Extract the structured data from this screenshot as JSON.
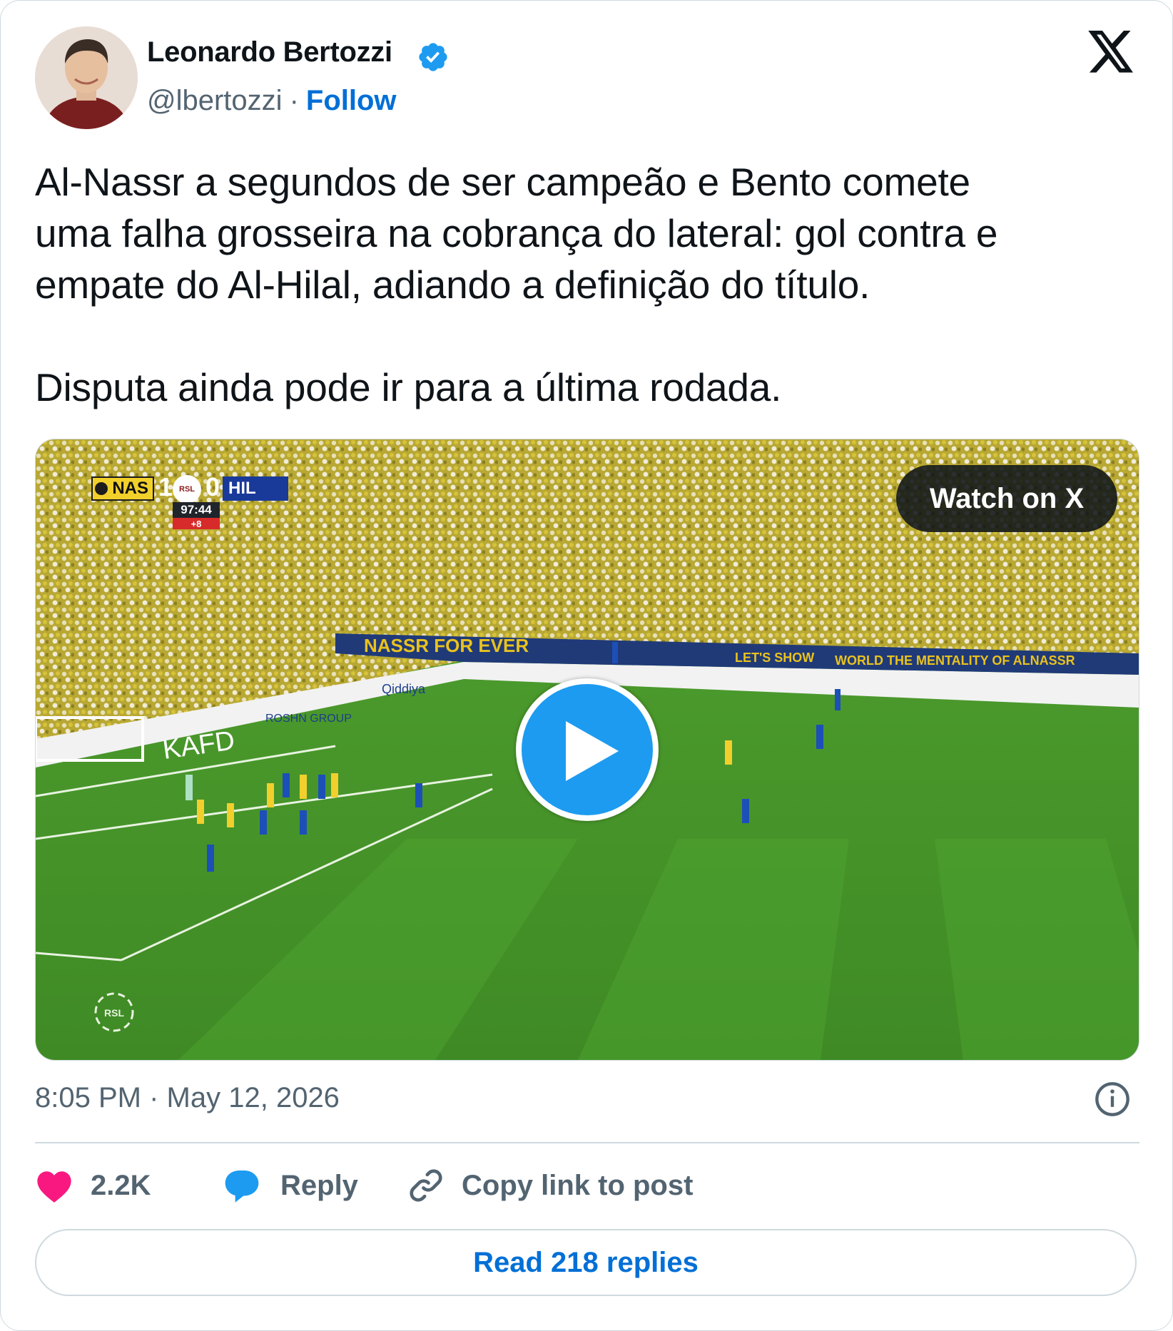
{
  "author": {
    "name": "Leonardo Bertozzi",
    "handle": "@lbertozzi",
    "separator": "·",
    "follow_label": "Follow",
    "verified": true
  },
  "tweet": {
    "text": "Al-Nassr a segundos de ser campeão e Bento comete\numa falha grosseira na cobrança do lateral: gol contra e\nempate do Al-Hilal, adiando a definição do título.\n\nDisputa ainda pode ir para a última rodada."
  },
  "media": {
    "watch_label": "Watch on X",
    "scoreboard": {
      "home_team": "NAS",
      "home_score": "1",
      "away_team": "HIL",
      "away_score": "0",
      "clock": "97:44",
      "added_time": "+8",
      "league_badge": "RSL"
    },
    "ad_boards": [
      "NASSR FOR EVER",
      "LET'S SHOW",
      "WORLD THE MENTALITY OF ALNASSR",
      "Qiddiya",
      "ROSHN GROUP",
      "KAFD"
    ],
    "watermark": "RSL"
  },
  "meta": {
    "time": "8:05 PM",
    "separator": "·",
    "date": "May 12, 2026"
  },
  "actions": {
    "like_count": "2.2K",
    "reply_label": "Reply",
    "copy_label": "Copy link to post"
  },
  "read_replies_label": "Read 218 replies",
  "colors": {
    "like": "#f91880",
    "reply": "#1d9bf0",
    "link": "#006fd6",
    "muted": "#536471",
    "border": "#cfd9de"
  },
  "icons": [
    "x-logo-icon",
    "verified-badge-icon",
    "play-icon",
    "info-icon",
    "heart-icon",
    "reply-bubble-icon",
    "link-icon"
  ]
}
